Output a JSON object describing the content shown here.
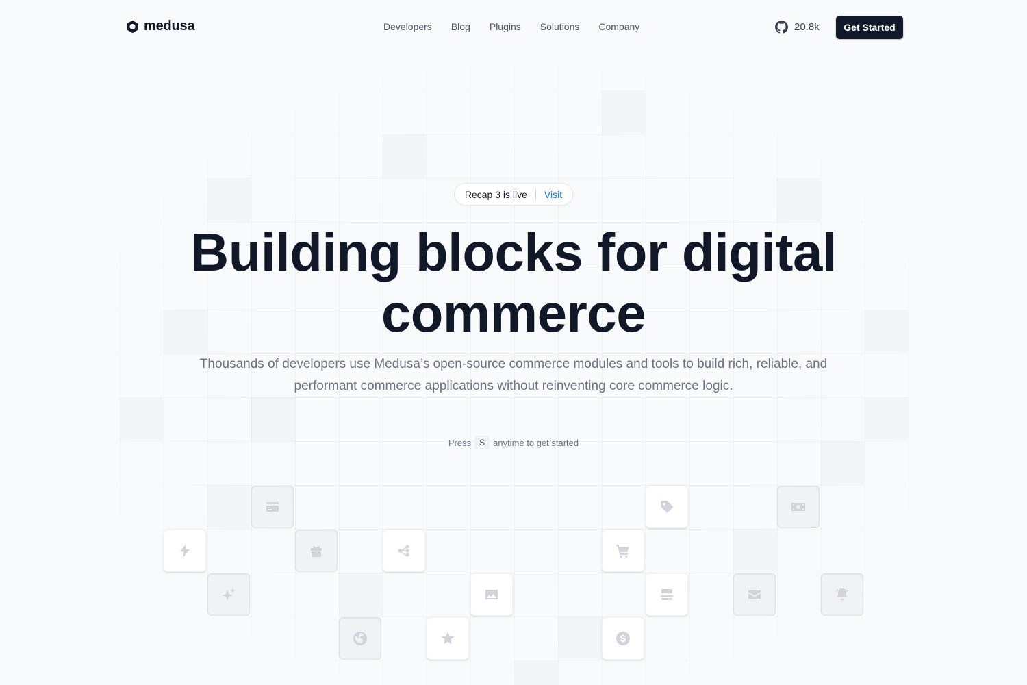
{
  "brand": {
    "name": "medusa"
  },
  "nav": {
    "items": [
      "Developers",
      "Blog",
      "Plugins",
      "Solutions",
      "Company"
    ]
  },
  "header": {
    "github_stars": "20.8k",
    "cta_label": "Get Started"
  },
  "announcement": {
    "text": "Recap 3 is live",
    "link_label": "Visit"
  },
  "hero": {
    "title_line1": "Building blocks for digital",
    "title_line2": "commerce",
    "subtitle_line1": "Thousands of developers use Medusa’s open-source commerce modules and tools to build rich, reliable, and",
    "subtitle_line2": "performant commerce applications without reinventing core commerce logic."
  },
  "shortcut": {
    "before": "Press",
    "key": "S",
    "after": "anytime to get started"
  },
  "tiles": [
    {
      "icon": "credit-card-icon",
      "style": "sunken"
    },
    {
      "icon": "lightning-icon",
      "style": "raised"
    },
    {
      "icon": "gift-icon",
      "style": "sunken"
    },
    {
      "icon": "share-nodes-icon",
      "style": "raised"
    },
    {
      "icon": "sparkles-icon",
      "style": "sunken"
    },
    {
      "icon": "image-icon",
      "style": "raised"
    },
    {
      "icon": "globe-icon",
      "style": "sunken"
    },
    {
      "icon": "star-icon",
      "style": "raised"
    },
    {
      "icon": "tag-icon",
      "style": "raised"
    },
    {
      "icon": "shopping-cart-icon",
      "style": "raised"
    },
    {
      "icon": "server-stack-icon",
      "style": "raised"
    },
    {
      "icon": "currency-icon",
      "style": "raised"
    },
    {
      "icon": "cash-icon",
      "style": "sunken"
    },
    {
      "icon": "envelope-icon",
      "style": "sunken"
    },
    {
      "icon": "bell-icon",
      "style": "sunken"
    }
  ],
  "colors": {
    "background": "#f9fafb",
    "text_primary": "#111827",
    "text_muted": "#6b7280",
    "link": "#0a7bd6",
    "cta_bg": "#111827"
  }
}
